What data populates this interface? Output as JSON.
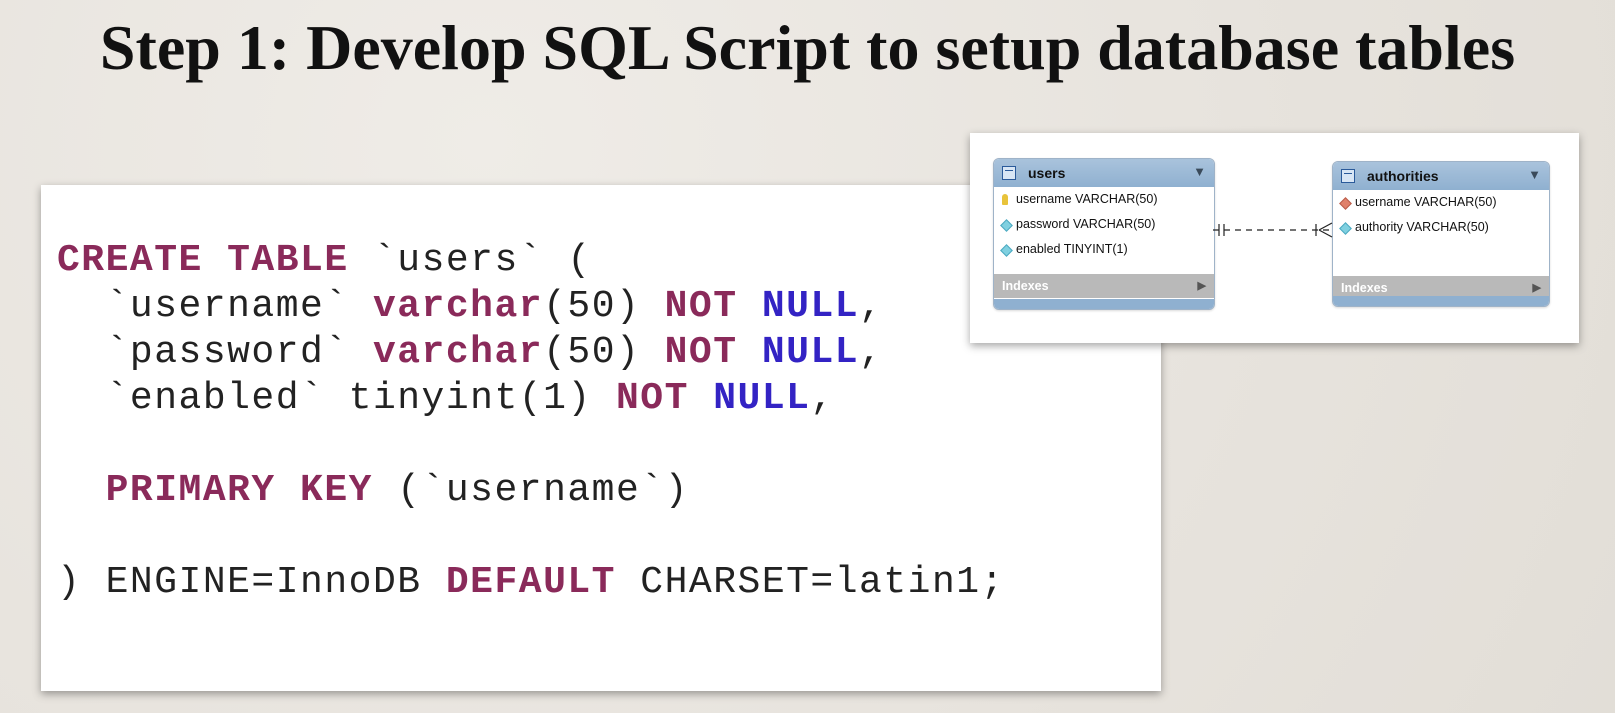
{
  "title": "Step 1: Develop SQL Script to setup database tables",
  "sql": {
    "line1": {
      "kw": "CREATE TABLE",
      "rest": " `users` ("
    },
    "line2": {
      "name": "  `username` ",
      "type": "varchar",
      "size": "(50) ",
      "notnull": "NOT",
      "null": "NULL",
      "comma": ","
    },
    "line3": {
      "name": "  `password` ",
      "type": "varchar",
      "size": "(50) ",
      "notnull": "NOT",
      "null": "NULL",
      "comma": ","
    },
    "line4": {
      "name": "  `enabled` tinyint(1) ",
      "notnull": "NOT",
      "null": "NULL",
      "comma": ","
    },
    "line5": {
      "indent": "  ",
      "kw": "PRIMARY KEY",
      "rest": " (`username`)"
    },
    "line6": {
      "start": ") ENGINE=InnoDB ",
      "kw": "DEFAULT",
      "rest": " CHARSET=latin1;"
    }
  },
  "diagram": {
    "users": {
      "name": "users",
      "fields": [
        "username VARCHAR(50)",
        "password VARCHAR(50)",
        "enabled TINYINT(1)"
      ],
      "indexes": "Indexes"
    },
    "authorities": {
      "name": "authorities",
      "fields": [
        "username VARCHAR(50)",
        "authority VARCHAR(50)"
      ],
      "indexes": "Indexes"
    },
    "icons": {
      "table": "table-icon",
      "primary_key": "key-icon",
      "foreign_key": "red-diamond-icon",
      "column": "cyan-diamond-icon",
      "collapse": "triangle-down-icon",
      "expand": "triangle-right-icon"
    },
    "colors": {
      "header": "#8fb0d0",
      "keyword": "#8a2a5a",
      "null_keyword": "#3323c4"
    }
  }
}
